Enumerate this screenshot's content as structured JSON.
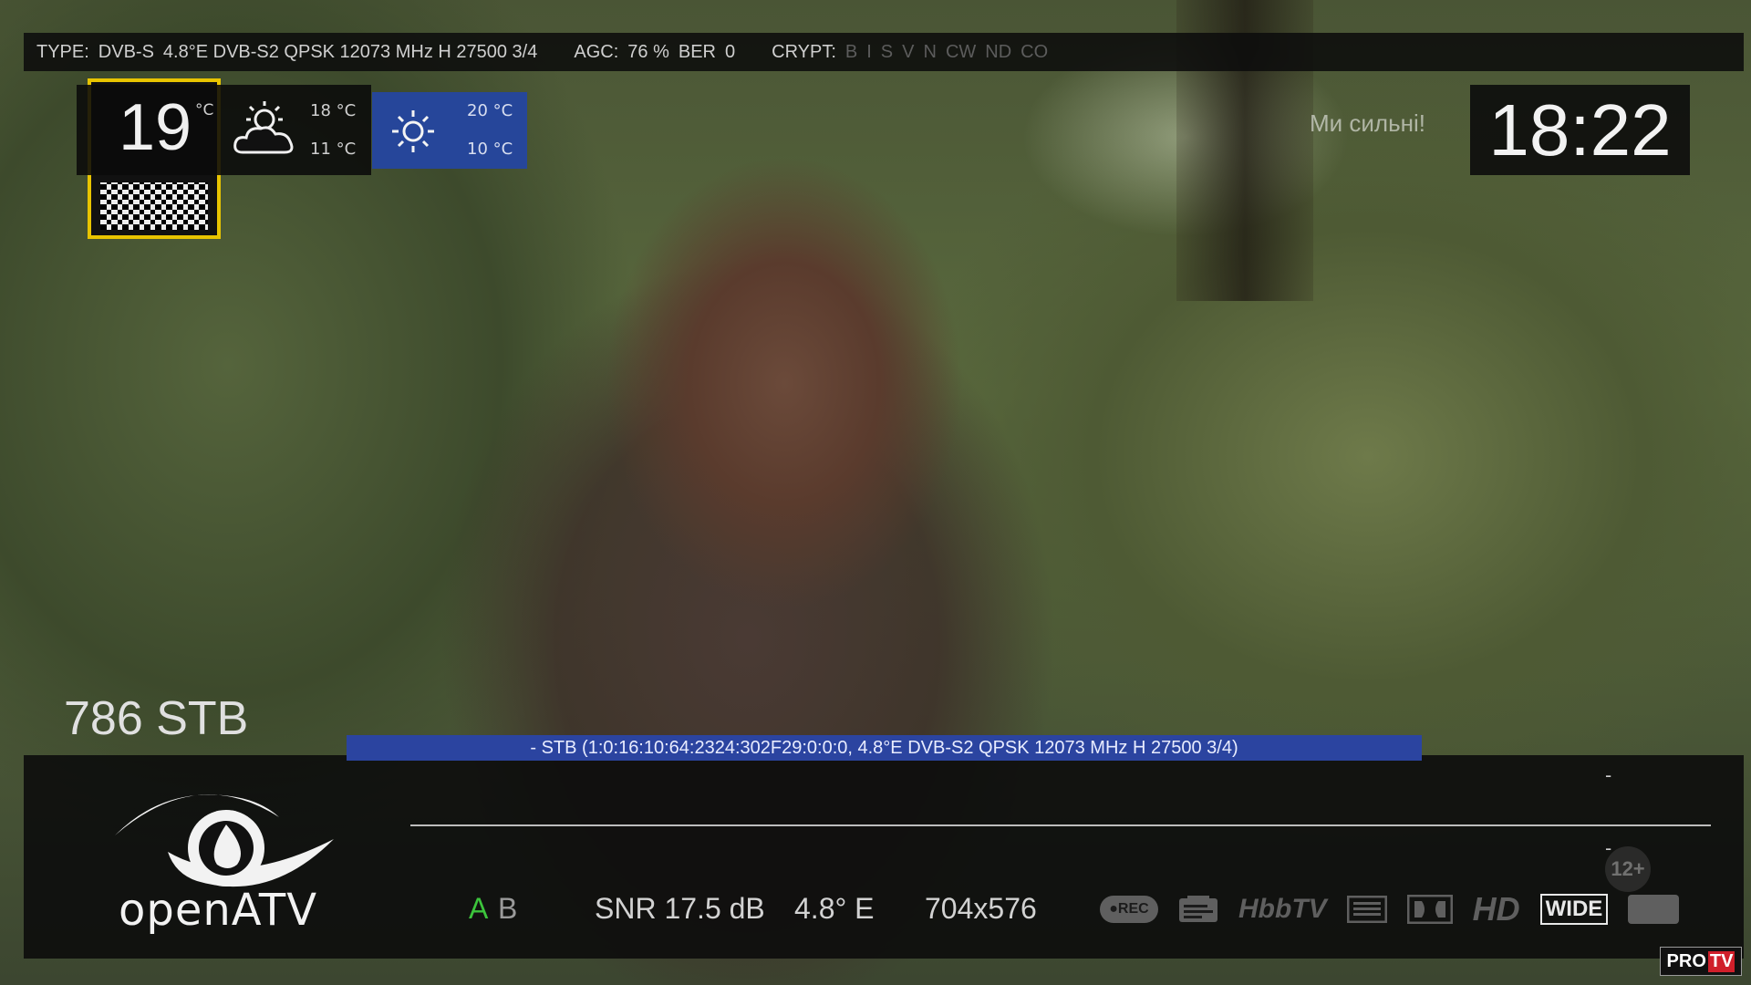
{
  "signal_bar": {
    "type_label": "TYPE:",
    "type_value": "DVB-S",
    "transponder": "4.8°E DVB-S2 QPSK 12073 MHz H 27500 3/4",
    "agc_label": "AGC:",
    "agc_value": "76 %",
    "ber_label": "BER",
    "ber_value": "0",
    "crypt_label": "CRYPT:",
    "crypt_flags": [
      "B",
      "I",
      "S",
      "V",
      "N",
      "CW",
      "ND",
      "CO"
    ]
  },
  "weather": {
    "current_temp": "19",
    "current_unit": "°C",
    "current_icon": "partly-cloudy-icon",
    "today_high": "18 °C",
    "today_low": "11 °C",
    "next_icon": "sun-icon",
    "next_high": "20 °C",
    "next_low": "10 °C"
  },
  "overlay_slogan": "Ми сильні!",
  "clock": "18:22",
  "channel": {
    "number_name": "786 STB",
    "service_ref": "- STB (1:0:16:10:64:2324:302F29:0:0:0, 4.8°E DVB-S2 QPSK 12073 MHz H 27500 3/4)"
  },
  "infobar": {
    "logo_text": "openATV",
    "now_dash": "-",
    "next_dash": "-",
    "age_rating": "12+",
    "tuner_a": "A",
    "tuner_b": "B",
    "snr": "SNR 17.5 dB",
    "orbital": "4.8° E",
    "resolution": "704x576",
    "icons": {
      "rec": "●REC",
      "hbbtv": "HbbTV",
      "hd": "HD",
      "wide": "WIDE"
    }
  },
  "corner_logo": {
    "pro": "PRO",
    "tv": "TV"
  },
  "colors": {
    "tuner_active": "#3cc43c",
    "service_strip": "#2b44a0",
    "weather_next_bg": "#26469a"
  }
}
